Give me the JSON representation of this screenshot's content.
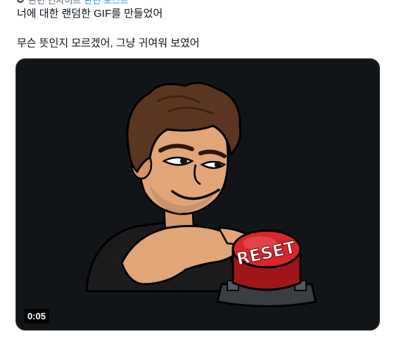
{
  "header": {
    "partial_text_before": "관련 인사이트",
    "partial_link": "관련 포스트"
  },
  "post": {
    "line1": "너에 대한 랜덤한 GIF를 만들었어",
    "line2": "무슨 뜻인지 모르겠어, 그냥 귀여워 보였어"
  },
  "media": {
    "button_text": "RESET",
    "duration": "0:05",
    "icon": "media-gif"
  },
  "colors": {
    "link": "#1d9bf0",
    "media_bg": "#121518",
    "button_red": "#d8262c"
  }
}
